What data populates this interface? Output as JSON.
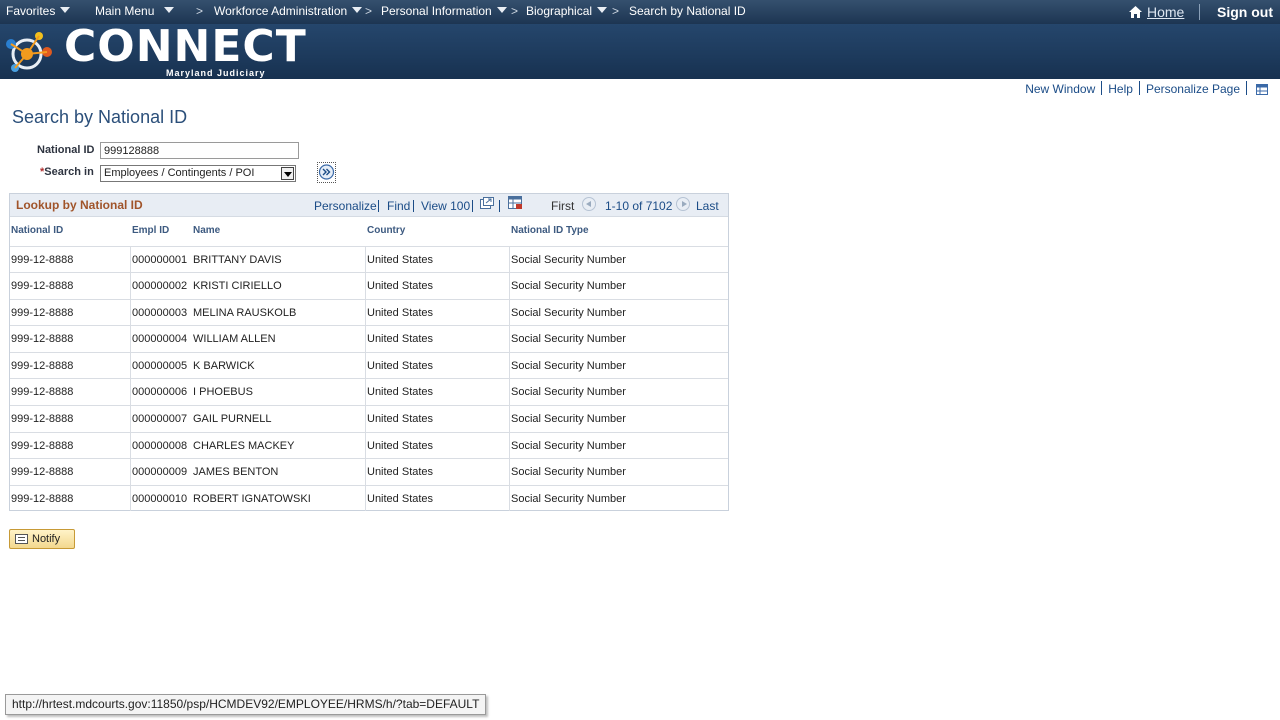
{
  "topnav": {
    "items": [
      {
        "label": "Favorites"
      },
      {
        "label": "Main Menu"
      },
      {
        "label": "Workforce Administration"
      },
      {
        "label": "Personal Information"
      },
      {
        "label": "Biographical"
      },
      {
        "label": "Search by National ID"
      }
    ],
    "home_label": "Home",
    "signout_label": "Sign out",
    "chevron": ">"
  },
  "banner": {
    "logo_text": "CONNECT",
    "logo_subtitle": "Maryland Judiciary"
  },
  "page_links": {
    "new_window": "New Window",
    "help": "Help",
    "personalize_page": "Personalize Page"
  },
  "page_title": "Search by National ID",
  "form": {
    "national_id_label": "National ID",
    "national_id_value": "999128888",
    "search_in_required": "*",
    "search_in_label": "Search in",
    "search_in_value": "Employees / Contingents / POI"
  },
  "grid": {
    "title": "Lookup by National ID",
    "tools": {
      "personalize": "Personalize",
      "find": "Find",
      "view": "View 100",
      "first": "First",
      "range": "1-10 of 7102",
      "last": "Last"
    },
    "columns": [
      "National ID",
      "Empl ID",
      "Name",
      "Country",
      "National ID Type"
    ],
    "rows": [
      [
        "999-12-8888",
        "000000001",
        "BRITTANY DAVIS",
        "United States",
        "Social Security Number"
      ],
      [
        "999-12-8888",
        "000000002",
        "KRISTI CIRIELLO",
        "United States",
        "Social Security Number"
      ],
      [
        "999-12-8888",
        "000000003",
        "MELINA RAUSKOLB",
        "United States",
        "Social Security Number"
      ],
      [
        "999-12-8888",
        "000000004",
        "WILLIAM ALLEN",
        "United States",
        "Social Security Number"
      ],
      [
        "999-12-8888",
        "000000005",
        "K BARWICK",
        "United States",
        "Social Security Number"
      ],
      [
        "999-12-8888",
        "000000006",
        "I PHOEBUS",
        "United States",
        "Social Security Number"
      ],
      [
        "999-12-8888",
        "000000007",
        "GAIL PURNELL",
        "United States",
        "Social Security Number"
      ],
      [
        "999-12-8888",
        "000000008",
        "CHARLES MACKEY",
        "United States",
        "Social Security Number"
      ],
      [
        "999-12-8888",
        "000000009",
        "JAMES BENTON",
        "United States",
        "Social Security Number"
      ],
      [
        "999-12-8888",
        "000000010",
        "ROBERT IGNATOWSKI",
        "United States",
        "Social Security Number"
      ]
    ]
  },
  "notify_label": "Notify",
  "status_url": "http://hrtest.mdcourts.gov:11850/psp/HCMDEV92/EMPLOYEE/HRMS/h/?tab=DEFAULT",
  "colors": {
    "nav_bg": "#1d3552",
    "banner_bg": "#1d3a5c",
    "link": "#1b4c87",
    "grid_title": "#a0542a"
  }
}
